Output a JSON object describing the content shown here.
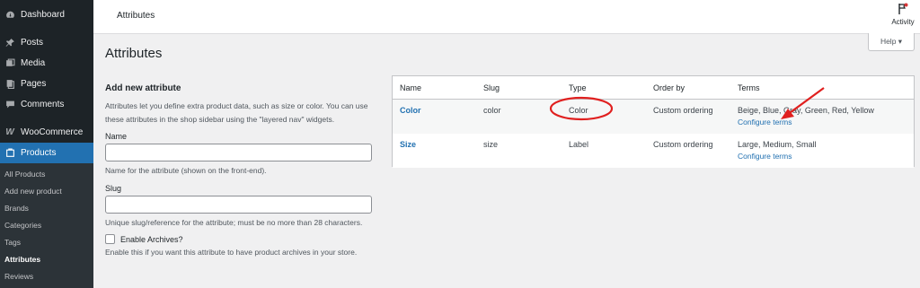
{
  "sidebar": {
    "items": [
      {
        "label": "Dashboard",
        "icon": "dashboard-icon"
      },
      {
        "label": "Posts",
        "icon": "pin-icon"
      },
      {
        "label": "Media",
        "icon": "media-icon"
      },
      {
        "label": "Pages",
        "icon": "pages-icon"
      },
      {
        "label": "Comments",
        "icon": "comments-icon"
      },
      {
        "label": "WooCommerce",
        "icon": "woocommerce-icon"
      },
      {
        "label": "Products",
        "icon": "products-icon"
      }
    ],
    "submenu": [
      "All Products",
      "Add new product",
      "Brands",
      "Categories",
      "Tags",
      "Attributes",
      "Reviews"
    ]
  },
  "topbar": {
    "title": "Attributes",
    "activity_label": "Activity"
  },
  "help_button": {
    "label": "Help ▾"
  },
  "page_title": "Attributes",
  "form": {
    "heading": "Add new attribute",
    "intro": "Attributes let you define extra product data, such as size or color. You can use these attributes in the shop sidebar using the \"layered nav\" widgets.",
    "name_label": "Name",
    "name_value": "",
    "name_desc": "Name for the attribute (shown on the front-end).",
    "slug_label": "Slug",
    "slug_value": "",
    "slug_desc": "Unique slug/reference for the attribute; must be no more than 28 characters.",
    "archives_label": "Enable Archives?",
    "archives_desc": "Enable this if you want this attribute to have product archives in your store."
  },
  "table": {
    "headers": {
      "name": "Name",
      "slug": "Slug",
      "type": "Type",
      "order": "Order by",
      "terms": "Terms"
    },
    "rows": [
      {
        "name": "Color",
        "slug": "color",
        "type": "Color",
        "order": "Custom ordering",
        "terms": "Beige, Blue, Gray, Green, Red, Yellow",
        "configure": "Configure terms"
      },
      {
        "name": "Size",
        "slug": "size",
        "type": "Label",
        "order": "Custom ordering",
        "terms": "Large, Medium, Small",
        "configure": "Configure terms"
      }
    ]
  },
  "colors": {
    "accent": "#2271b1",
    "sidebar": "#1d2327",
    "annotation": "#e0201f"
  }
}
